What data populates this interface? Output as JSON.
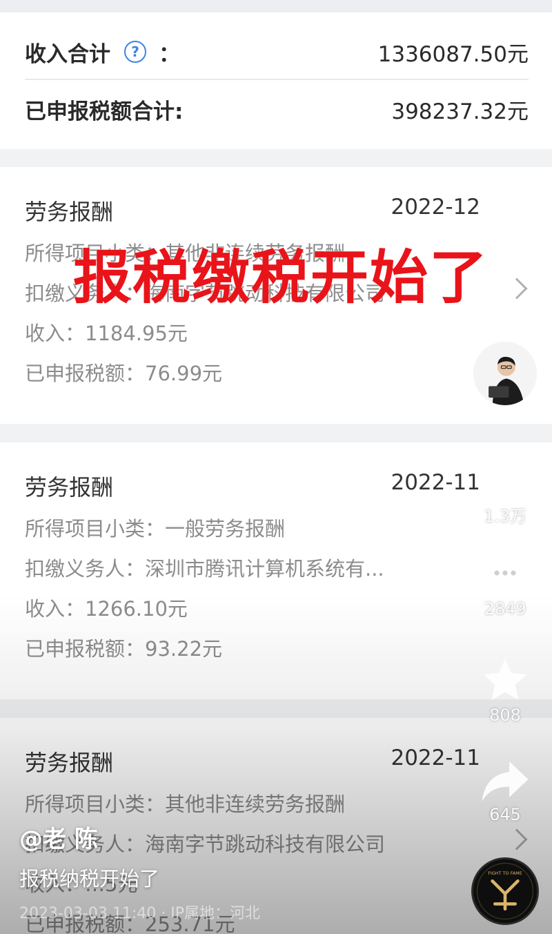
{
  "summary": {
    "income_label": "收入合计",
    "income_colon": "：",
    "help_glyph": "?",
    "income_value": "1336087.50元",
    "tax_label": "已申报税额合计:",
    "tax_value": "398237.32元"
  },
  "records": [
    {
      "title": "劳务报酬",
      "date": "2022-12",
      "subtype": "所得项目小类：其他非连续劳务报酬",
      "payer": "扣缴义务人：海南字节跳动科技有限公司",
      "income": "收入：1184.95元",
      "tax": "已申报税额：76.99元"
    },
    {
      "title": "劳务报酬",
      "date": "2022-11",
      "subtype": "所得项目小类：一般劳务报酬",
      "payer": "扣缴义务人：深圳市腾讯计算机系统有...",
      "income": "收入：1266.10元",
      "tax": "已申报税额：93.22元"
    },
    {
      "title": "劳务报酬",
      "date": "2022-11",
      "subtype": "所得项目小类：其他非连续劳务报酬",
      "payer": "扣缴义务人：海南字节跳动科技有限公司",
      "income": "收入：…5元",
      "tax": "已申报税额：253.71元"
    }
  ],
  "overlay_title": "报税缴税开始了",
  "side_actions": {
    "likes": "1.3万",
    "comments": "2849",
    "favorites": "808",
    "shares": "645"
  },
  "author": "@老 陈",
  "caption": "报税纳税开始了",
  "meta": "2023-03-03 11:40 · IP属地：河北",
  "disc_text": "FIGHT TO FAME",
  "colors": {
    "overlay_red": "#e8141a",
    "help_blue": "#3d82e6"
  }
}
